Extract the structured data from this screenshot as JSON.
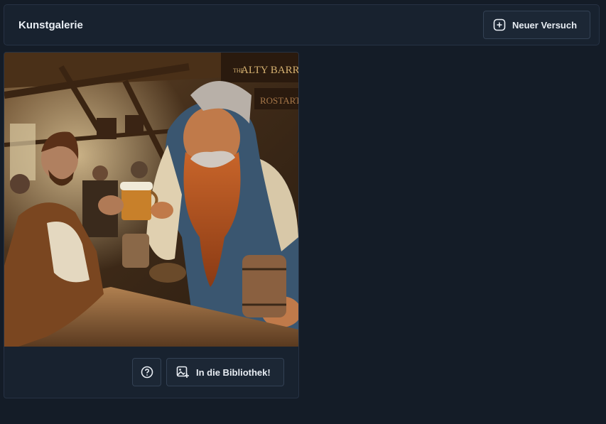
{
  "header": {
    "title": "Kunstgalerie",
    "new_attempt_label": "Neuer Versuch"
  },
  "artwork": {
    "sign_text_top": "ALTY BARREL",
    "sign_text_prefix": "THE",
    "sign_text_side": "ROSTART"
  },
  "actions": {
    "help_icon": "question-circle-icon",
    "library_label": "In die Bibliothek!"
  },
  "colors": {
    "background": "#141c27",
    "panel": "#18222f",
    "border": "#263244",
    "text": "#e8edf3"
  }
}
